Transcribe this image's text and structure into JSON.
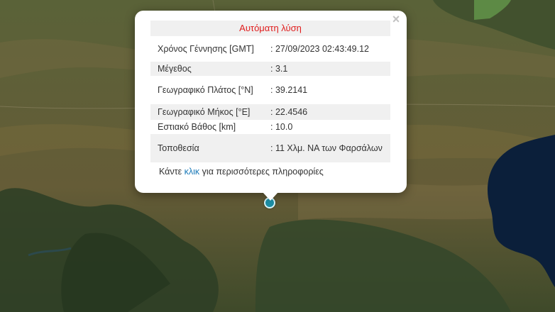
{
  "popup": {
    "title": "Αυτόματη λύση",
    "close_symbol": "×",
    "rows": [
      {
        "label": "Χρόνος Γέννησης [GMT]",
        "value": ": 27/09/2023 02:43:49.12"
      },
      {
        "label": "Μέγεθος",
        "value": ": 3.1"
      },
      {
        "label": "Γεωγραφικό Πλάτος [°N]",
        "value": ": 39.2141"
      },
      {
        "label": "Γεωγραφικό Μήκος [°E]",
        "value": ": 22.4546"
      },
      {
        "label": "Εστιακό Βάθος [km]",
        "value": ": 10.0"
      },
      {
        "label": "Τοποθεσία",
        "value": ": 11 Χλμ. ΝΑ των Φαρσάλων"
      }
    ],
    "footer": {
      "prefix": "Κάντε ",
      "link": "κλικ",
      "suffix": " για περισσότερες πληροφορίες"
    }
  },
  "map": {
    "type": "satellite",
    "marker_icon": "earthquake-epicenter-marker",
    "marker_color": "#1c8ea5",
    "water_color": "#0b1f3a"
  }
}
